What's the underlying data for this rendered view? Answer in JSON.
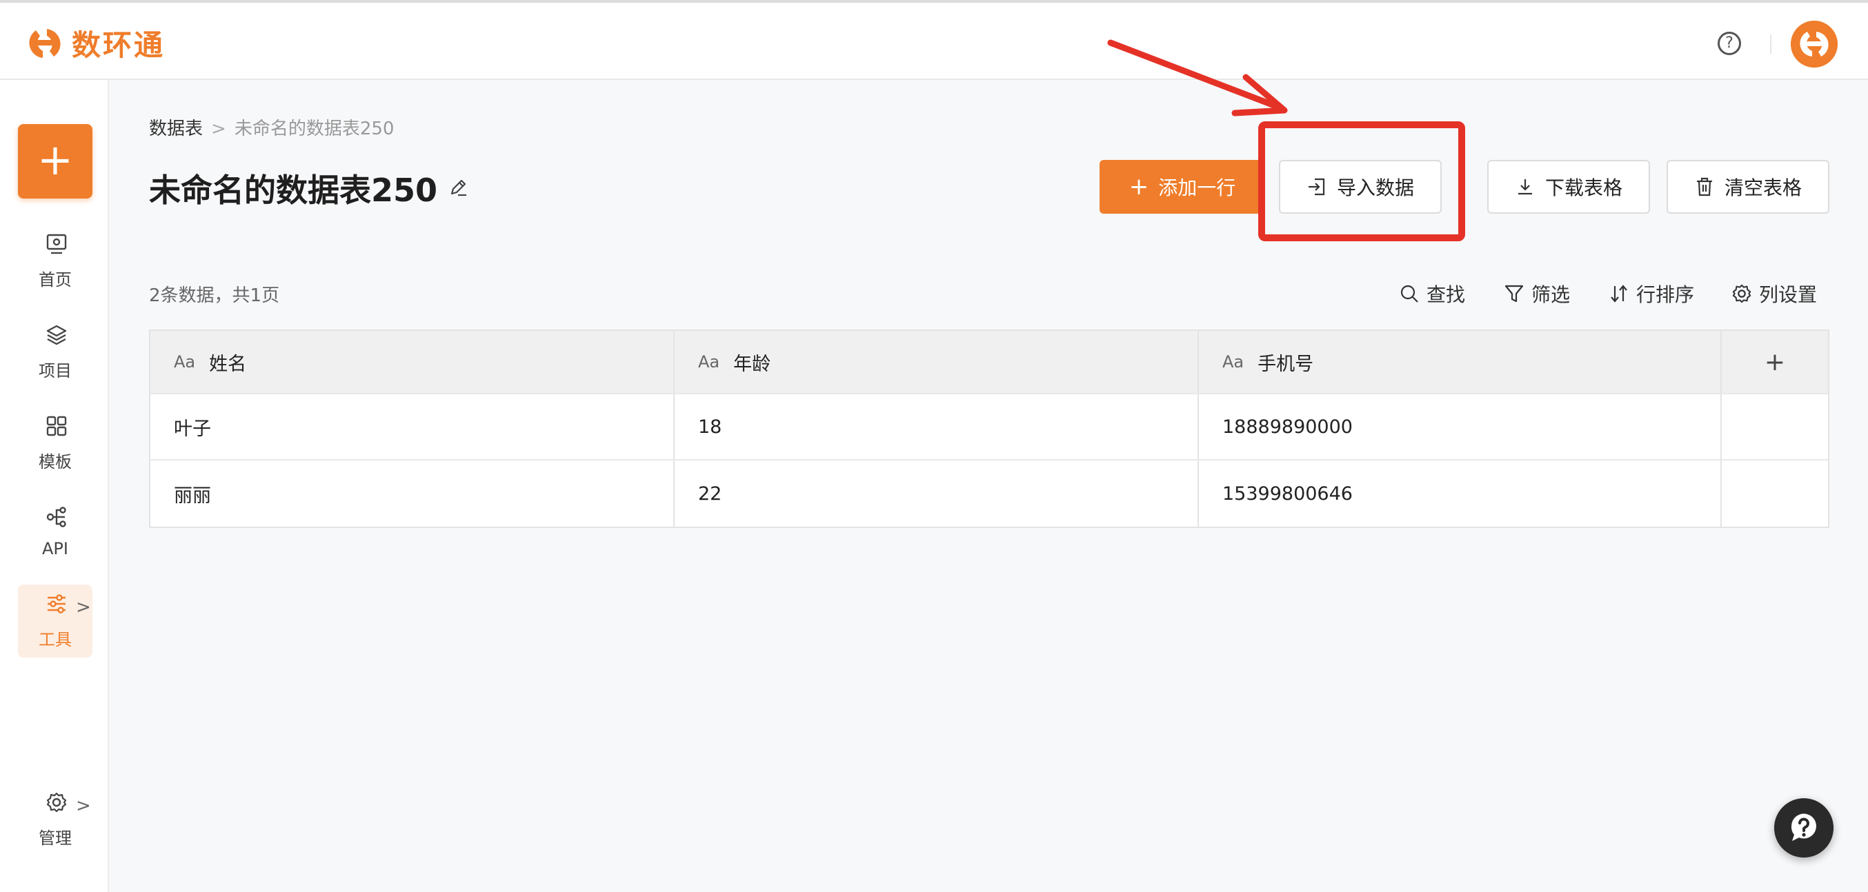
{
  "app": {
    "name": "数环通"
  },
  "header": {
    "help_icon": "help-circle-icon",
    "avatar_icon": "brand-logo-icon"
  },
  "sidebar": {
    "add_label": "+",
    "items": [
      {
        "label": "首页",
        "icon": "monitor-icon"
      },
      {
        "label": "项目",
        "icon": "layers-icon"
      },
      {
        "label": "模板",
        "icon": "grid-icon"
      },
      {
        "label": "API",
        "icon": "api-icon"
      },
      {
        "label": "工具",
        "icon": "sliders-icon",
        "active": true,
        "chevron": ">"
      }
    ],
    "manage": {
      "label": "管理",
      "icon": "gear-icon",
      "chevron": ">"
    }
  },
  "breadcrumb": {
    "root": "数据表",
    "separator": ">",
    "current": "未命名的数据表250"
  },
  "page": {
    "title": "未命名的数据表250"
  },
  "actions": {
    "add_row": "添加一行",
    "import": "导入数据",
    "download": "下载表格",
    "clear": "清空表格"
  },
  "summary": {
    "count_text": "2条数据，共1页"
  },
  "tools": {
    "search": "查找",
    "filter": "筛选",
    "sort": "行排序",
    "columns": "列设置"
  },
  "table": {
    "type_badge": "Aa",
    "add_column": "+",
    "columns": [
      "姓名",
      "年龄",
      "手机号"
    ],
    "rows": [
      [
        "叶子",
        "18",
        "18889890000"
      ],
      [
        "丽丽",
        "22",
        "15399800646"
      ]
    ]
  },
  "colors": {
    "accent": "#ef7d2b",
    "annotation": "#e53227"
  }
}
